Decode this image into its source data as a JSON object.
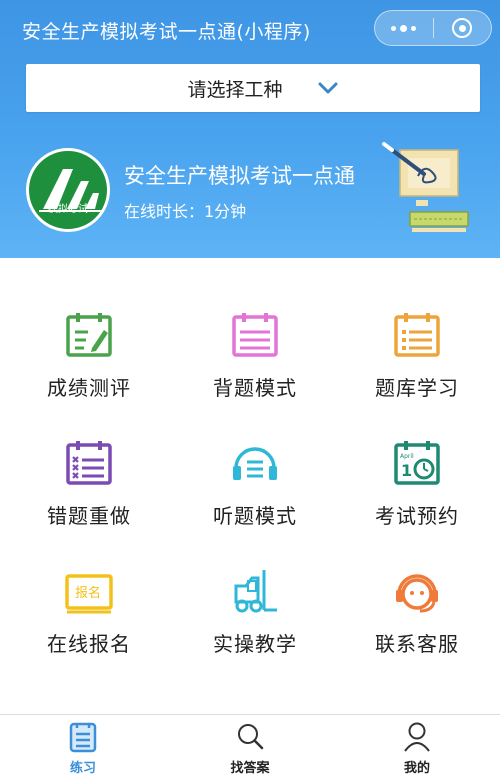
{
  "title_bar": {
    "title": "安全生产模拟考试一点通(小程序)"
  },
  "selector": {
    "label": "请选择工种"
  },
  "profile": {
    "logo_text": "模拟考试",
    "app_name": "安全生产模拟考试一点通",
    "online_time": "在线时长：1分钟"
  },
  "colors": {
    "header": "#4aa3ee",
    "green": "#4aa34a",
    "pink": "#e374d6",
    "orange": "#eea43a",
    "purple": "#7b4ab3",
    "cyan": "#2fb7d8",
    "teal": "#1f8a72",
    "yellow": "#f3c21a",
    "tab_active": "#3a8fd8"
  },
  "grid": {
    "items": [
      {
        "label": "成绩测评",
        "icon": "clipboard-pencil-icon"
      },
      {
        "label": "背题模式",
        "icon": "notebook-icon"
      },
      {
        "label": "题库学习",
        "icon": "list-notebook-icon"
      },
      {
        "label": "错题重做",
        "icon": "wrong-list-icon"
      },
      {
        "label": "听题模式",
        "icon": "headphones-icon"
      },
      {
        "label": "考试预约",
        "icon": "calendar-clock-icon"
      },
      {
        "label": "在线报名",
        "icon": "signup-tag-icon"
      },
      {
        "label": "实操教学",
        "icon": "forklift-icon"
      },
      {
        "label": "联系客服",
        "icon": "customer-service-icon"
      }
    ],
    "calendar_month": "April",
    "calendar_day": "1",
    "signup_text": "报名"
  },
  "tabbar": {
    "items": [
      {
        "label": "练习",
        "icon": "practice-doc-icon",
        "active": true
      },
      {
        "label": "找答案",
        "icon": "search-icon",
        "active": false
      },
      {
        "label": "我的",
        "icon": "user-icon",
        "active": false
      }
    ]
  }
}
